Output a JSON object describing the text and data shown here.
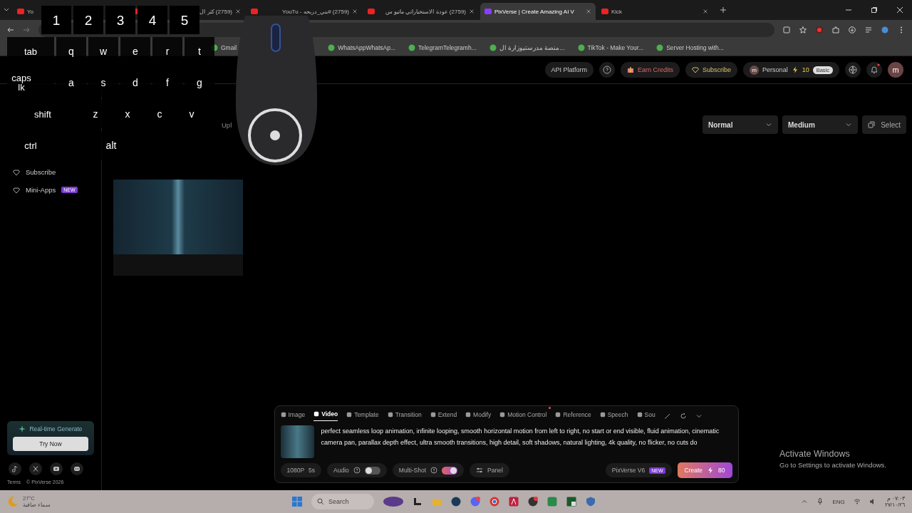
{
  "browser": {
    "tabs": [
      {
        "title": "Yo",
        "selected": false
      },
      {
        "title": "(2759) كثر ال",
        "selected": false
      },
      {
        "title": "(2759) #بني_دربحه - YouTu",
        "selected": false
      },
      {
        "title": "(2759) عودة الاستخباراتي ماتيو س",
        "selected": false
      },
      {
        "title": "PixVerse | Create Amazing AI V",
        "selected": true
      },
      {
        "title": "Kick",
        "selected": false
      }
    ],
    "bookmarks": [
      "Gmail",
      "WhatsAppWhatsAp...",
      "TelegramTelegramh...",
      "منصة مدرستيوزارة ال...",
      "TikTok - Make Your...",
      "Server Hosting with..."
    ]
  },
  "header": {
    "api": "API Platform",
    "earn": "Earn Credits",
    "subscribe": "Subscribe",
    "account_initial": "m",
    "account": "Personal",
    "credits": "10",
    "plan": "Basic",
    "avatar": "m"
  },
  "sidebar": {
    "items": [
      {
        "label": "Subscribe"
      },
      {
        "label": "Mini-Apps",
        "badge": "NEW"
      }
    ],
    "promo": {
      "title": "Real-time Generate",
      "button": "Try Now"
    },
    "terms": "Terms",
    "copyright": "© PixVerse 2026"
  },
  "main": {
    "partial_tab": "Upl",
    "filters": [
      "Normal",
      "Medium"
    ],
    "select": "Select"
  },
  "composer": {
    "tabs": [
      {
        "label": "Image",
        "selected": false,
        "dot": false
      },
      {
        "label": "Video",
        "selected": true,
        "dot": false
      },
      {
        "label": "Template",
        "selected": false,
        "dot": false
      },
      {
        "label": "Transition",
        "selected": false,
        "dot": false
      },
      {
        "label": "Extend",
        "selected": false,
        "dot": false
      },
      {
        "label": "Modify",
        "selected": false,
        "dot": false
      },
      {
        "label": "Motion Control",
        "selected": false,
        "dot": true
      },
      {
        "label": "Reference",
        "selected": false,
        "dot": false
      },
      {
        "label": "Speech",
        "selected": false,
        "dot": false
      },
      {
        "label": "Sou",
        "selected": false,
        "dot": false
      }
    ],
    "prompt": "perfect seamless loop animation, infinite looping, smooth horizontal motion from left to right, no start or end visible, fluid animation, cinematic camera pan, parallax depth effect, ultra smooth transitions, high detail, soft shadows, natural lighting, 4k quality, no flicker, no cuts do",
    "resolution": "1080P",
    "duration": "5s",
    "toggles": [
      {
        "label": "Audio",
        "on": false
      },
      {
        "label": "Multi-Shot",
        "on": true
      }
    ],
    "panel": "Panel",
    "model": "PixVerse V6",
    "model_badge": "NEW",
    "create": "Create",
    "cost": "80"
  },
  "activation": {
    "title": "Activate Windows",
    "subtitle": "Go to Settings to activate Windows."
  },
  "taskbar": {
    "temperature": "27°C",
    "weather": "سماء صافية",
    "search": "Search",
    "language": "ENG",
    "time": "٠٧:٠٣ م",
    "date": "٢٧/١٠/٢٦"
  },
  "keyboard_overlay": {
    "rows": [
      [
        "1",
        "2",
        "3",
        "4",
        "5"
      ],
      [
        "tab",
        "q",
        "w",
        "e",
        "r",
        "t"
      ],
      [
        "caps lk",
        "a",
        "s",
        "d",
        "f",
        "g"
      ],
      [
        "shift",
        "z",
        "x",
        "c",
        "v"
      ],
      [
        "ctrl",
        "alt"
      ]
    ]
  }
}
